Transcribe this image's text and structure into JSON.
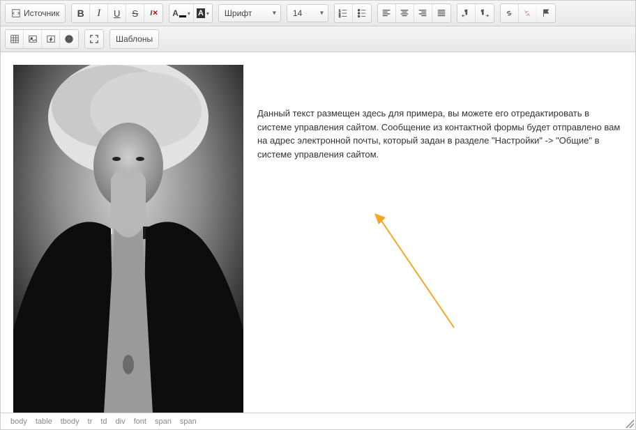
{
  "toolbar": {
    "source": "Источник",
    "bold": "B",
    "italic": "I",
    "underline": "U",
    "strike": "S",
    "font_label": "Шрифт",
    "font_size": "14",
    "templates": "Шаблоны"
  },
  "content": {
    "text": "Данный текст размещен здесь для примера, вы можете его отредактировать в системе управления сайтом. Сообщение из контактной формы будет отправлено вам на адрес электронной почты, который задан в разделе \"Настройки\" -> \"Общие\" в системе управления сайтом."
  },
  "statusbar": {
    "path": [
      "body",
      "table",
      "tbody",
      "tr",
      "td",
      "div",
      "font",
      "span",
      "span"
    ]
  },
  "colors": {
    "arrow": "#f5a623"
  }
}
